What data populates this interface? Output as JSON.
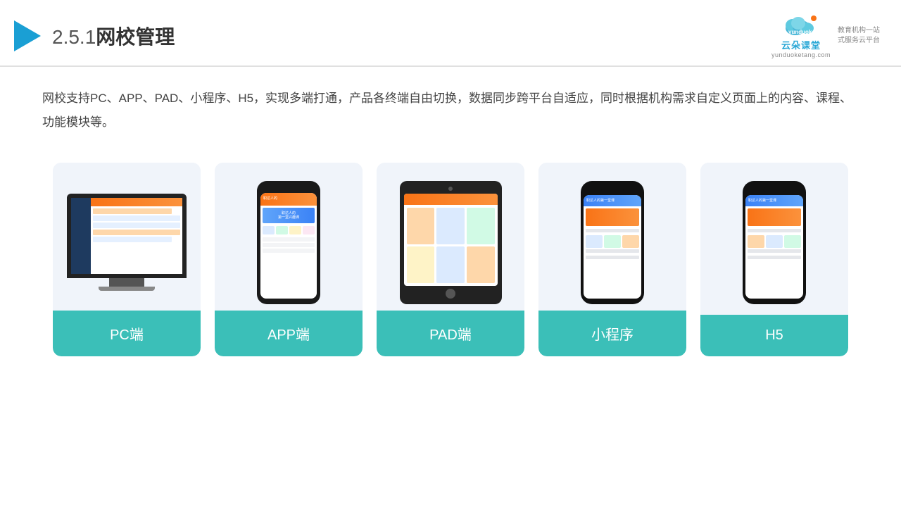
{
  "header": {
    "section": "2.5.1",
    "title": "网校管理",
    "logo_main": "云朵课堂",
    "logo_sub": "yunduoketang.com",
    "logo_tagline_1": "教育机构一站",
    "logo_tagline_2": "式服务云平台"
  },
  "description": {
    "text": "网校支持PC、APP、PAD、小程序、H5，实现多端打通，产品各终端自由切换，数据同步跨平台自适应，同时根据机构需求自定义页面上的内容、课程、功能模块等。"
  },
  "cards": [
    {
      "id": "pc",
      "label": "PC端"
    },
    {
      "id": "app",
      "label": "APP端"
    },
    {
      "id": "pad",
      "label": "PAD端"
    },
    {
      "id": "mini",
      "label": "小程序"
    },
    {
      "id": "h5",
      "label": "H5"
    }
  ]
}
